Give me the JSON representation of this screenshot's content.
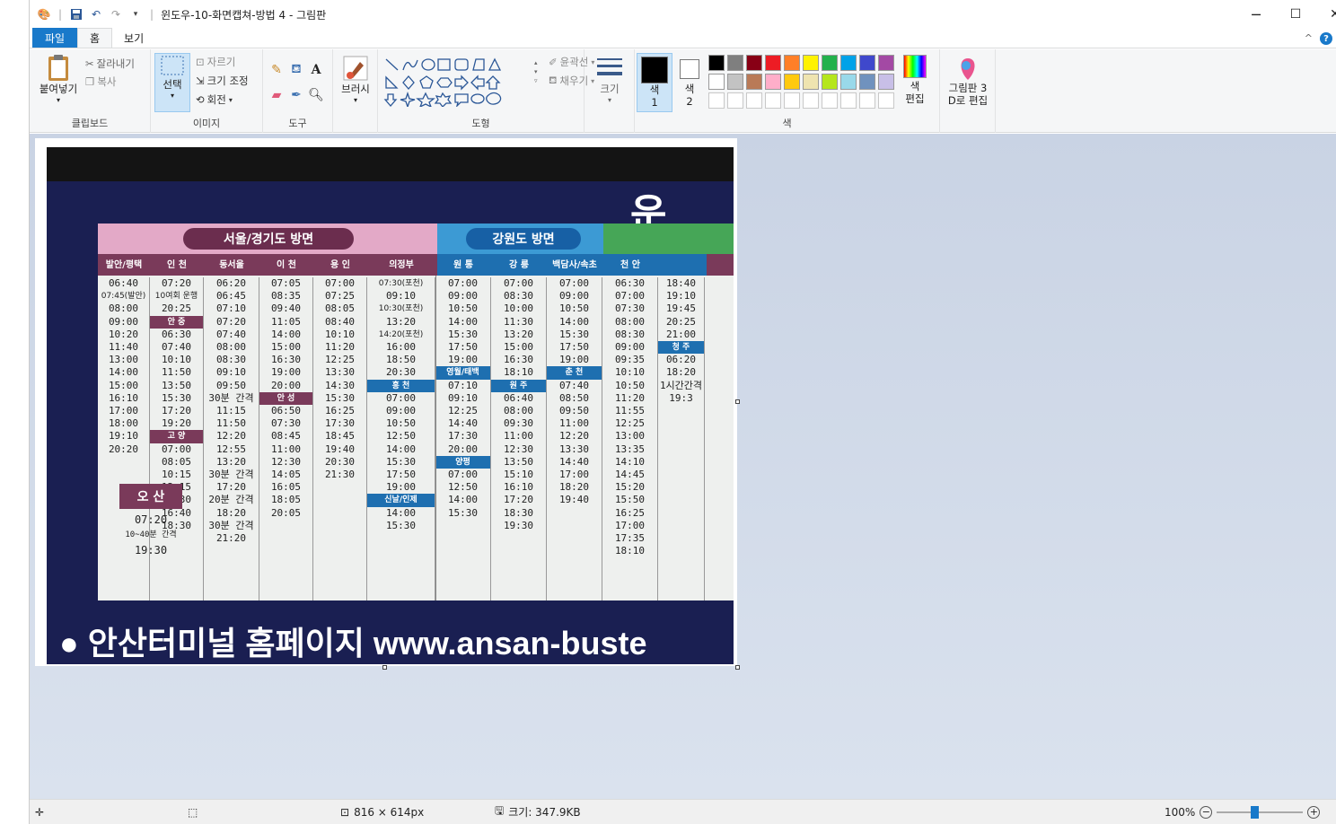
{
  "window": {
    "title": "윈도우-10-화면캡쳐-방법 4 - 그림판",
    "minimize": "─",
    "maximize": "☐",
    "close": "✕"
  },
  "quick_access": {
    "paint_icon": "paint-app-icon",
    "save_icon": "save-icon",
    "undo_icon": "undo-icon",
    "redo_icon": "redo-icon",
    "customize_icon": "dropdown-icon"
  },
  "tabs": {
    "file": "파일",
    "home": "홈",
    "view": "보기"
  },
  "ribbon": {
    "clipboard": {
      "label": "클립보드",
      "paste": "붙여넣기",
      "cut": "잘라내기",
      "copy": "복사"
    },
    "image": {
      "label": "이미지",
      "select": "선택",
      "crop": "자르기",
      "resize": "크기 조정",
      "rotate": "회전"
    },
    "tools": {
      "label": "도구"
    },
    "brushes": {
      "label": "브러시"
    },
    "shapes": {
      "label": "도형",
      "outline": "윤곽선",
      "fill": "채우기"
    },
    "size": {
      "label": "크기"
    },
    "colors": {
      "label": "색",
      "color1": "색\n1",
      "color2": "색\n2",
      "edit_colors": "색\n편집",
      "palette_row1": [
        "#000000",
        "#7f7f7f",
        "#880015",
        "#ed1c24",
        "#ff7f27",
        "#fff200",
        "#22b14c",
        "#00a2e8",
        "#3f48cc",
        "#a349a4"
      ],
      "palette_row2": [
        "#ffffff",
        "#c3c3c3",
        "#b97a57",
        "#ffaec9",
        "#ffc90e",
        "#efe4b0",
        "#b5e61d",
        "#99d9ea",
        "#7092be",
        "#c8bfe7"
      ]
    },
    "paint3d": {
      "label": "그림판 3\nD로 편집"
    }
  },
  "photo": {
    "sign_top": "운",
    "board": {
      "head_seoul": "서울/경기도 방면",
      "head_gangwon": "강원도 방면",
      "cols": [
        {
          "name": "발안/평택",
          "times": [
            "06:40",
            "07:45(발안)",
            "08:00",
            "09:00",
            "10:20",
            "11:40",
            "13:00",
            "14:00",
            "15:00",
            "16:10",
            "17:00",
            "18:00",
            "19:10",
            "20:20"
          ]
        },
        {
          "name": "인 천",
          "times": [
            "07:20",
            "10여회 운행",
            "20:25",
            "안 중",
            "06:30",
            "07:40",
            "10:10",
            "11:50",
            "13:50",
            "15:30",
            "17:20",
            "19:20",
            "고 양",
            "07:00",
            "08:05",
            "10:15",
            "12:15",
            "14:30",
            "16:40",
            "18:30"
          ]
        },
        {
          "name": "동서울",
          "times": [
            "06:20",
            "06:45",
            "07:10",
            "07:20",
            "07:40",
            "08:00",
            "08:30",
            "09:10",
            "09:50",
            "30분 간격",
            "11:15",
            "11:50",
            "12:20",
            "12:55",
            "13:20",
            "30분 간격",
            "17:20",
            "20분 간격",
            "18:20",
            "30분 간격",
            "21:20"
          ]
        },
        {
          "name": "이 천",
          "times": [
            "07:05",
            "08:35",
            "09:40",
            "11:05",
            "14:00",
            "15:00",
            "16:30",
            "19:00",
            "20:00",
            "안 성",
            "06:50",
            "07:30",
            "08:45",
            "11:00",
            "12:30",
            "14:05",
            "16:05",
            "18:05",
            "20:05"
          ]
        },
        {
          "name": "용 인",
          "times": [
            "07:00",
            "07:25",
            "08:05",
            "08:40",
            "10:10",
            "11:20",
            "12:25",
            "13:30",
            "14:30",
            "15:30",
            "16:25",
            "17:30",
            "18:45",
            "19:40",
            "20:30",
            "21:30"
          ]
        },
        {
          "name": "의정부",
          "times": [
            "07:30(포천)",
            "09:10",
            "10:30(포천)",
            "13:20",
            "14:20(포천)",
            "16:00",
            "18:50",
            "20:30",
            "홍 천",
            "07:00",
            "09:00",
            "10:50",
            "12:50",
            "14:00",
            "15:30",
            "17:50",
            "19:00",
            "신날/인제",
            "14:00",
            "15:30"
          ]
        },
        {
          "name": "원 통",
          "times": [
            "07:00",
            "09:00",
            "10:50",
            "14:00",
            "15:30",
            "17:50",
            "19:00",
            "영월/태백",
            "07:10",
            "09:10",
            "12:25",
            "14:40",
            "17:30",
            "20:00",
            "양평",
            "07:00",
            "12:50",
            "14:00",
            "15:30"
          ]
        },
        {
          "name": "강 릉",
          "times": [
            "07:00",
            "08:30",
            "10:00",
            "11:30",
            "13:20",
            "15:00",
            "16:30",
            "18:10",
            "원 주",
            "06:40",
            "08:00",
            "09:30",
            "11:00",
            "12:30",
            "13:50",
            "15:10",
            "16:10",
            "17:20",
            "18:30",
            "19:30"
          ]
        },
        {
          "name": "백담사/속초",
          "times": [
            "07:00",
            "09:00",
            "10:50",
            "14:00",
            "15:30",
            "17:50",
            "19:00",
            "춘 천",
            "07:40",
            "08:50",
            "09:50",
            "11:00",
            "12:20",
            "13:30",
            "14:40",
            "17:00",
            "18:20",
            "19:40"
          ]
        },
        {
          "name": "천 안",
          "times": [
            "06:30",
            "07:00",
            "07:30",
            "08:00",
            "08:30",
            "09:00",
            "09:35",
            "10:10",
            "10:50",
            "11:20",
            "11:55",
            "12:25",
            "13:00",
            "13:35",
            "14:10",
            "14:45",
            "15:20",
            "15:50",
            "16:25",
            "17:00",
            "17:35",
            "18:10"
          ]
        },
        {
          "name": "",
          "times": [
            "18:40",
            "19:10",
            "19:45",
            "20:25",
            "21:00",
            "청 주",
            "06:20",
            "18:20",
            "1시간간격",
            "19:3"
          ]
        }
      ],
      "oisan": "오 산",
      "oisan_times": [
        "07:20",
        "10~40분 간격",
        "19:30"
      ],
      "footer": "● 안산터미널 홈페이지 www.ansan-buste"
    }
  },
  "status": {
    "dimensions": "816 × 614px",
    "size": "크기: 347.9KB",
    "zoom": "100%"
  }
}
